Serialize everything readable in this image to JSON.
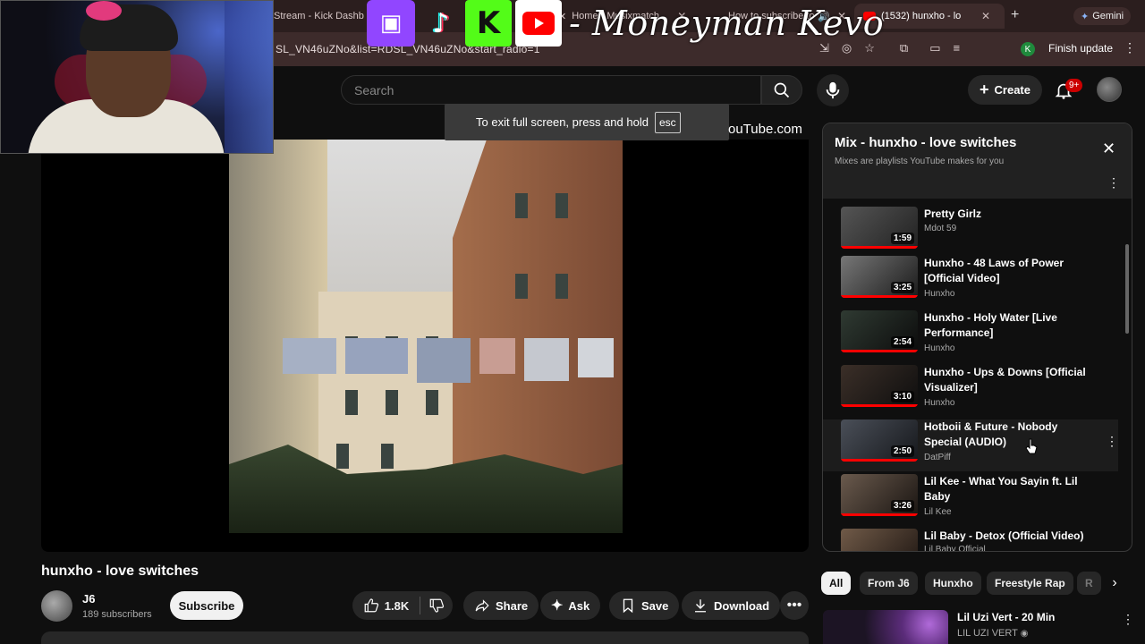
{
  "browser": {
    "tabs": [
      {
        "title": "Stream - Kick Dashb"
      },
      {
        "title": "Home - Musixmatch"
      },
      {
        "title": "How to subscribe to"
      },
      {
        "title": "(1532) hunxho - lo"
      }
    ],
    "gemini_label": "Gemini",
    "url": "SL_VN46uZNo&list=RDSL_VN46uZNo&start_radio=1",
    "profile_initial": "K",
    "finish_update_label": "Finish update"
  },
  "overlay": {
    "streamer_name": "- Moneyman Kevo",
    "social_icons": [
      "twitch-icon",
      "tiktok-icon",
      "kick-icon",
      "youtube-icon"
    ]
  },
  "header": {
    "search_placeholder": "Search",
    "create_label": "Create",
    "notification_badge": "9+"
  },
  "fullscreen_toast": {
    "message": "To exit full screen, press and hold",
    "key": "esc"
  },
  "watermark": "ouTube.com",
  "video": {
    "title": "hunxho - love switches",
    "channel": "J6",
    "subscribers": "189 subscribers",
    "subscribe_label": "Subscribe",
    "likes": "1.8K",
    "share_label": "Share",
    "ask_label": "Ask",
    "save_label": "Save",
    "download_label": "Download"
  },
  "playlist": {
    "title": "Mix - hunxho - love switches",
    "subtitle": "Mixes are playlists YouTube makes for you",
    "items": [
      {
        "title": "Pretty Girlz",
        "channel": "Mdot 59",
        "duration": "1:59"
      },
      {
        "title": "Hunxho - 48 Laws of Power [Official Video]",
        "channel": "Hunxho",
        "duration": "3:25"
      },
      {
        "title": "Hunxho - Holy Water [Live Performance]",
        "channel": "Hunxho",
        "duration": "2:54"
      },
      {
        "title": "Hunxho - Ups & Downs [Official Visualizer]",
        "channel": "Hunxho",
        "duration": "3:10"
      },
      {
        "title": "Hotboii & Future - Nobody Special (AUDIO)",
        "channel": "DatPiff",
        "duration": "2:50"
      },
      {
        "title": "Lil Kee - What You Sayin ft. Lil Baby",
        "channel": "Lil Kee",
        "duration": "3:26"
      },
      {
        "title": "Lil Baby - Detox (Official Video)",
        "channel": "Lil Baby Official",
        "duration": ""
      }
    ]
  },
  "chips": [
    "All",
    "From J6",
    "Hunxho",
    "Freestyle Rap",
    "R"
  ],
  "recommendation": {
    "title": "Lil Uzi Vert - 20 Min",
    "channel": "LIL UZI VERT"
  },
  "colors": {
    "accent_red": "#ff0000",
    "background": "#0f0f0f",
    "twitch": "#9146ff",
    "kick": "#53fc18"
  }
}
